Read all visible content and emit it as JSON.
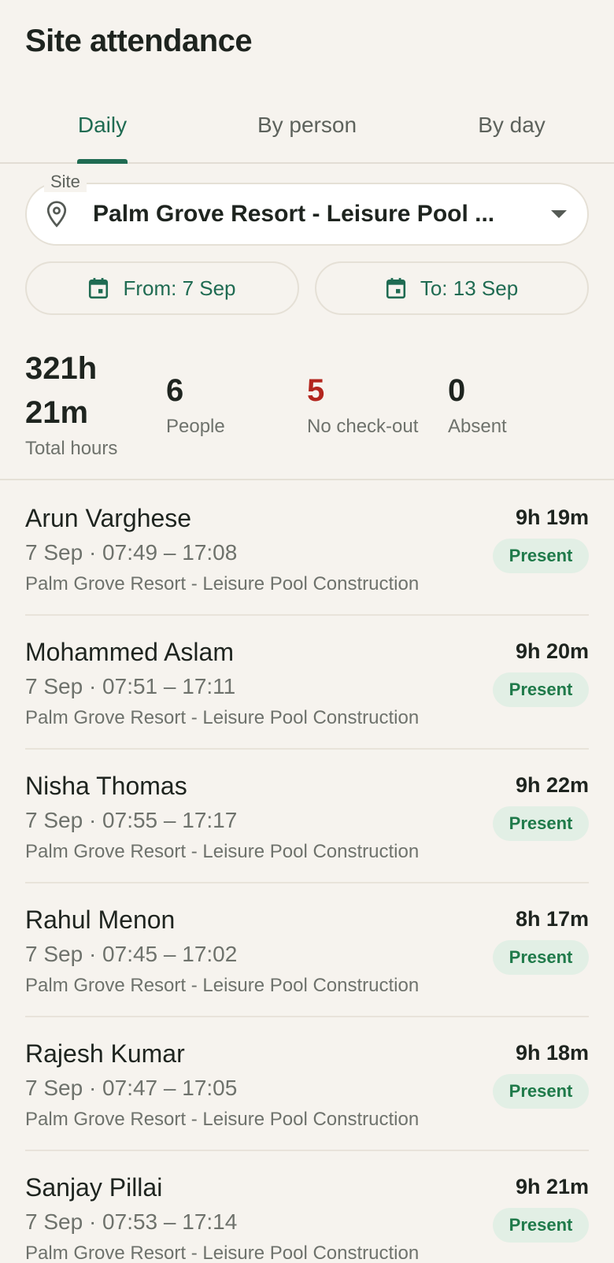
{
  "header": {
    "title": "Site attendance"
  },
  "tabs": [
    {
      "label": "Daily",
      "active": true
    },
    {
      "label": "By person",
      "active": false
    },
    {
      "label": "By day",
      "active": false
    }
  ],
  "site_filter": {
    "label": "Site",
    "value": "Palm Grove Resort - Leisure Pool ..."
  },
  "date_range": {
    "from_label": "From: 7 Sep",
    "to_label": "To: 13 Sep"
  },
  "stats": {
    "total_hours_line1": "321h",
    "total_hours_line2": "21m",
    "total_hours_label": "Total hours",
    "people_value": "6",
    "people_label": "People",
    "no_checkout_value": "5",
    "no_checkout_label": "No check-out",
    "absent_value": "0",
    "absent_label": "Absent"
  },
  "colors": {
    "accent": "#1f6b52",
    "warning": "#b3261e",
    "badge_bg": "#e2efe5",
    "badge_text": "#1f7a4a",
    "background": "#f6f3ee"
  },
  "records": [
    {
      "name": "Arun Varghese",
      "times": "7 Sep · 07:49 – 17:08",
      "site": "Palm Grove Resort - Leisure Pool Construction",
      "hours": "9h 19m",
      "status": "Present"
    },
    {
      "name": "Mohammed Aslam",
      "times": "7 Sep · 07:51 – 17:11",
      "site": "Palm Grove Resort - Leisure Pool Construction",
      "hours": "9h 20m",
      "status": "Present"
    },
    {
      "name": "Nisha Thomas",
      "times": "7 Sep · 07:55 – 17:17",
      "site": "Palm Grove Resort - Leisure Pool Construction",
      "hours": "9h 22m",
      "status": "Present"
    },
    {
      "name": "Rahul Menon",
      "times": "7 Sep · 07:45 – 17:02",
      "site": "Palm Grove Resort - Leisure Pool Construction",
      "hours": "8h 17m",
      "status": "Present"
    },
    {
      "name": "Rajesh Kumar",
      "times": "7 Sep · 07:47 – 17:05",
      "site": "Palm Grove Resort - Leisure Pool Construction",
      "hours": "9h 18m",
      "status": "Present"
    },
    {
      "name": "Sanjay Pillai",
      "times": "7 Sep · 07:53 – 17:14",
      "site": "Palm Grove Resort - Leisure Pool Construction",
      "hours": "9h 21m",
      "status": "Present"
    }
  ]
}
